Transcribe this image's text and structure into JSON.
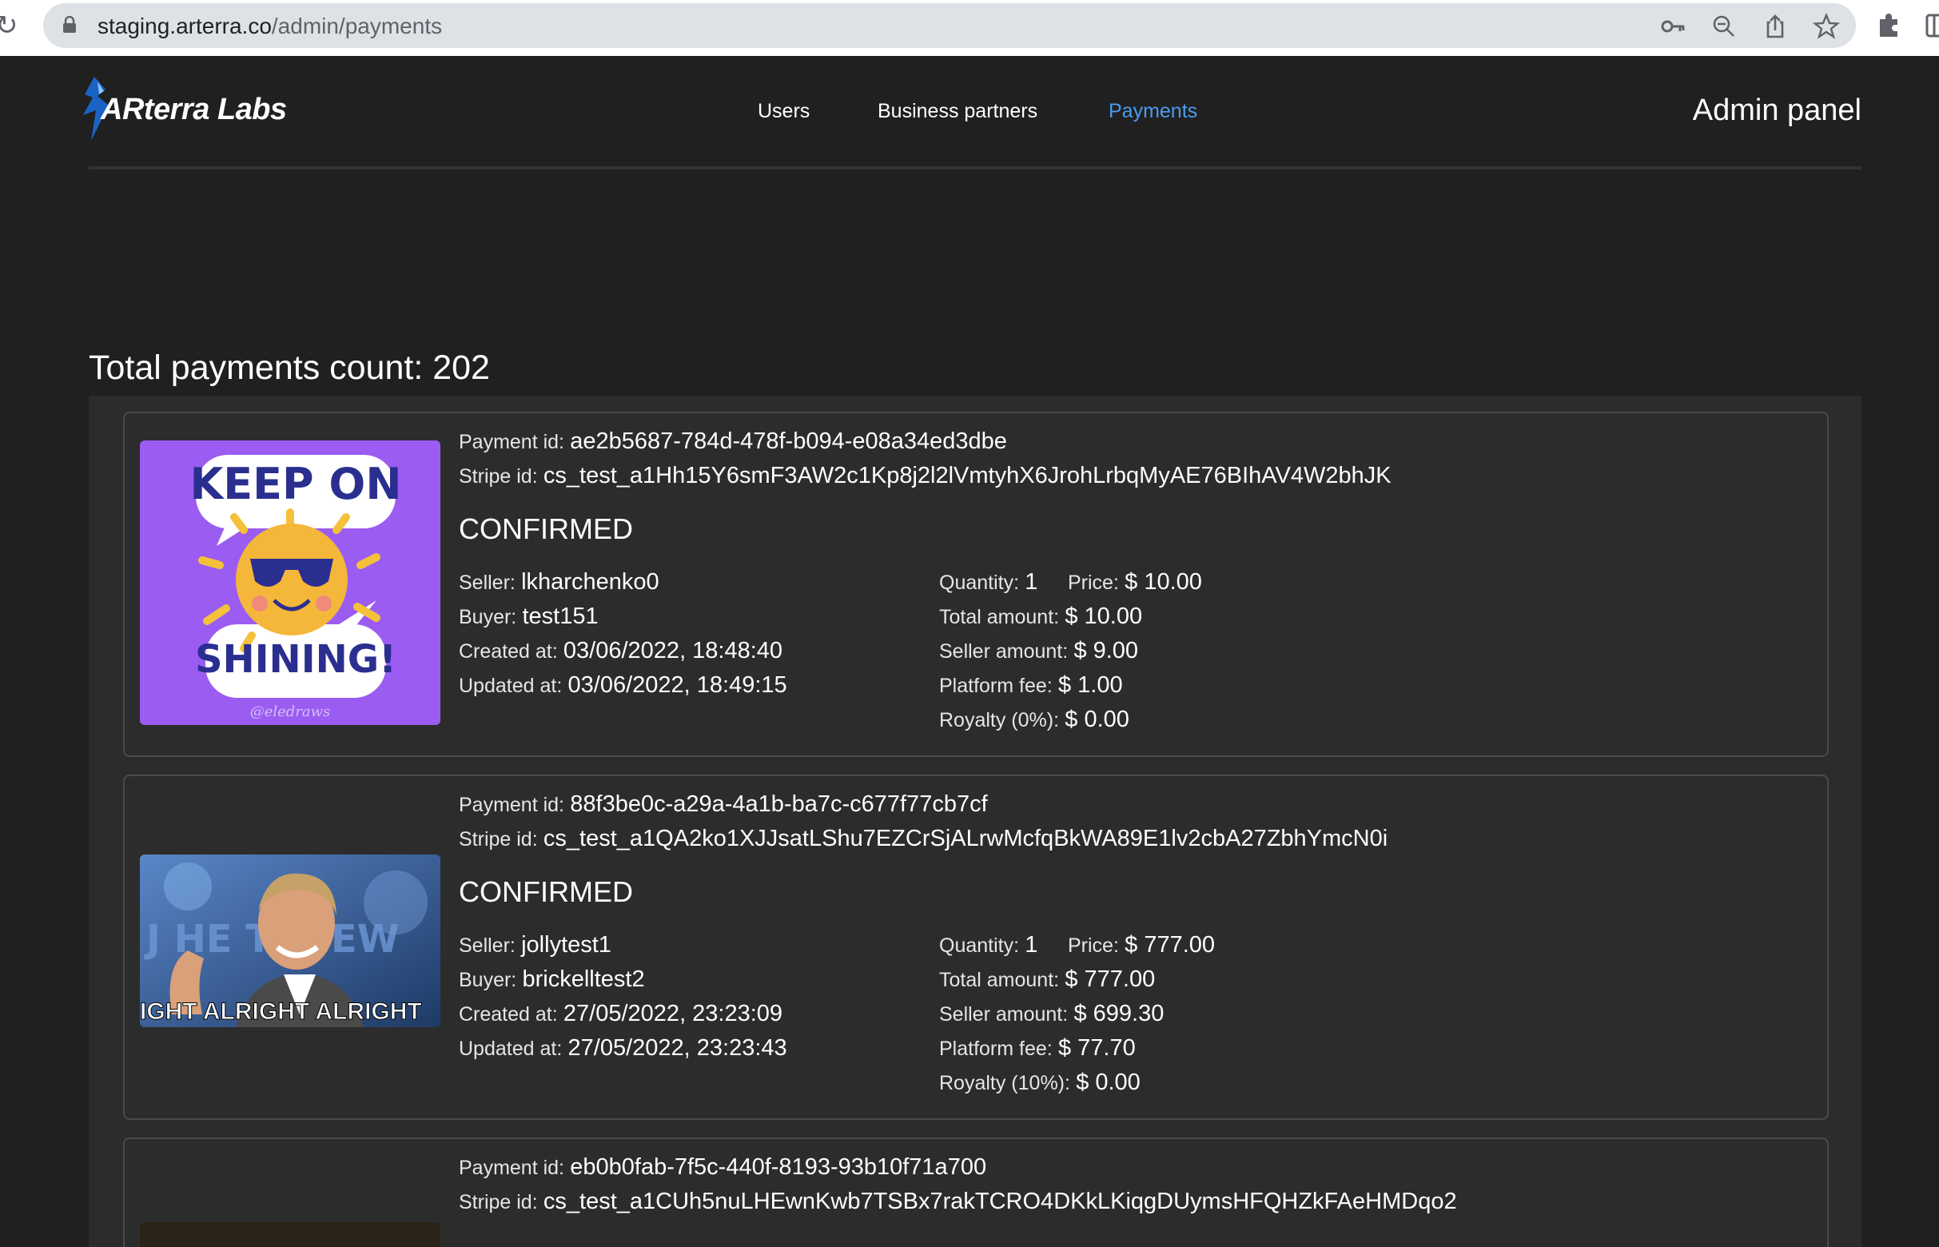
{
  "browser": {
    "url_host": "staging.arterra.co",
    "url_path": "/admin/payments"
  },
  "header": {
    "logo_text": "ARterra Labs",
    "nav": [
      {
        "label": "Users"
      },
      {
        "label": "Business partners"
      },
      {
        "label": "Payments",
        "active": true
      }
    ],
    "admin_title": "Admin panel",
    "accent_color": "#4a9cf0"
  },
  "total_label": "Total payments count: 202",
  "labels": {
    "payment_id": "Payment id:",
    "stripe_id": "Stripe id:",
    "seller": "Seller:",
    "buyer": "Buyer:",
    "created_at": "Created at:",
    "updated_at": "Updated at:",
    "quantity": "Quantity:",
    "price": "Price:",
    "total_amount": "Total amount:",
    "seller_amount": "Seller amount:",
    "platform_fee": "Platform fee:"
  },
  "payments": [
    {
      "payment_id": "ae2b5687-784d-478f-b094-e08a34ed3dbe",
      "stripe_id": "cs_test_a1Hh15Y6smF3AW2c1Kp8j2l2lVmtyhX6JrohLrbqMyAE76BIhAV4W2bhJK",
      "status": "CONFIRMED",
      "seller": "lkharchenko0",
      "buyer": "test151",
      "created_at": "03/06/2022, 18:48:40",
      "updated_at": "03/06/2022, 18:49:15",
      "quantity": "1",
      "price": "$ 10.00",
      "total_amount": "$ 10.00",
      "seller_amount": "$ 9.00",
      "platform_fee": "$ 1.00",
      "royalty_label": "Royalty (0%):",
      "royalty": "$ 0.00",
      "image": {
        "top_text": "KEEP ON",
        "bottom_text": "SHINING!",
        "credit": "@eledraws",
        "bg_color": "#9b5cf2"
      }
    },
    {
      "payment_id": "88f3be0c-a29a-4a1b-ba7c-c677f77cb7cf",
      "stripe_id": "cs_test_a1QA2ko1XJJsatLShu7EZCrSjALrwMcfqBkWA89E1lv2cbA27ZbhYmcN0i",
      "status": "CONFIRMED",
      "seller": "jollytest1",
      "buyer": "brickelltest2",
      "created_at": "27/05/2022, 23:23:09",
      "updated_at": "27/05/2022, 23:23:43",
      "quantity": "1",
      "price": "$ 777.00",
      "total_amount": "$ 777.00",
      "seller_amount": "$ 699.30",
      "platform_fee": "$ 77.70",
      "royalty_label": "Royalty (10%):",
      "royalty": "$ 0.00",
      "image": {
        "caption": "IGHT ALRIGHT ALRIGHT",
        "background_text": "J HE   TTHEW"
      }
    },
    {
      "payment_id": "eb0b0fab-7f5c-440f-8193-93b10f71a700",
      "stripe_id": "cs_test_a1CUh5nuLHEwnKwb7TSBx7rakTCRO4DKkLKiqgDUymsHFQHZkFAeHMDqo2"
    }
  ]
}
